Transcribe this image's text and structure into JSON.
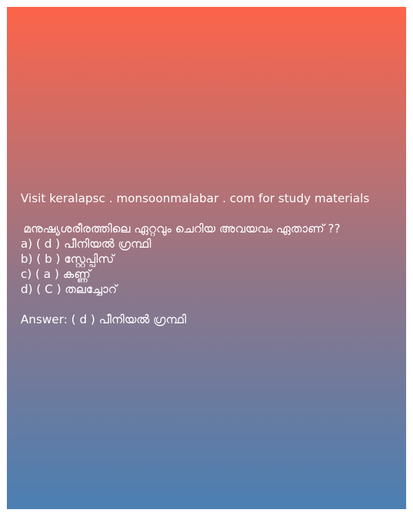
{
  "site_line": "Visit keralapsc . monsoonmalabar . com for study materials",
  "question": "മനുഷ്യശരീരത്തിലെ ഏറ്റവും ചെറിയ അവയവം ഏതാണ് ??",
  "options": [
    "a) ( d ) പീനിയൽ ഗ്രന്ഥി",
    "b) ( b ) സ്റ്റേപ്പിസ്",
    "c) ( a ) കണ്ണ്",
    "d) ( C ) തലച്ചോറ്"
  ],
  "answer": "Answer: ( d ) പീനിയൽ ഗ്രന്ഥി"
}
